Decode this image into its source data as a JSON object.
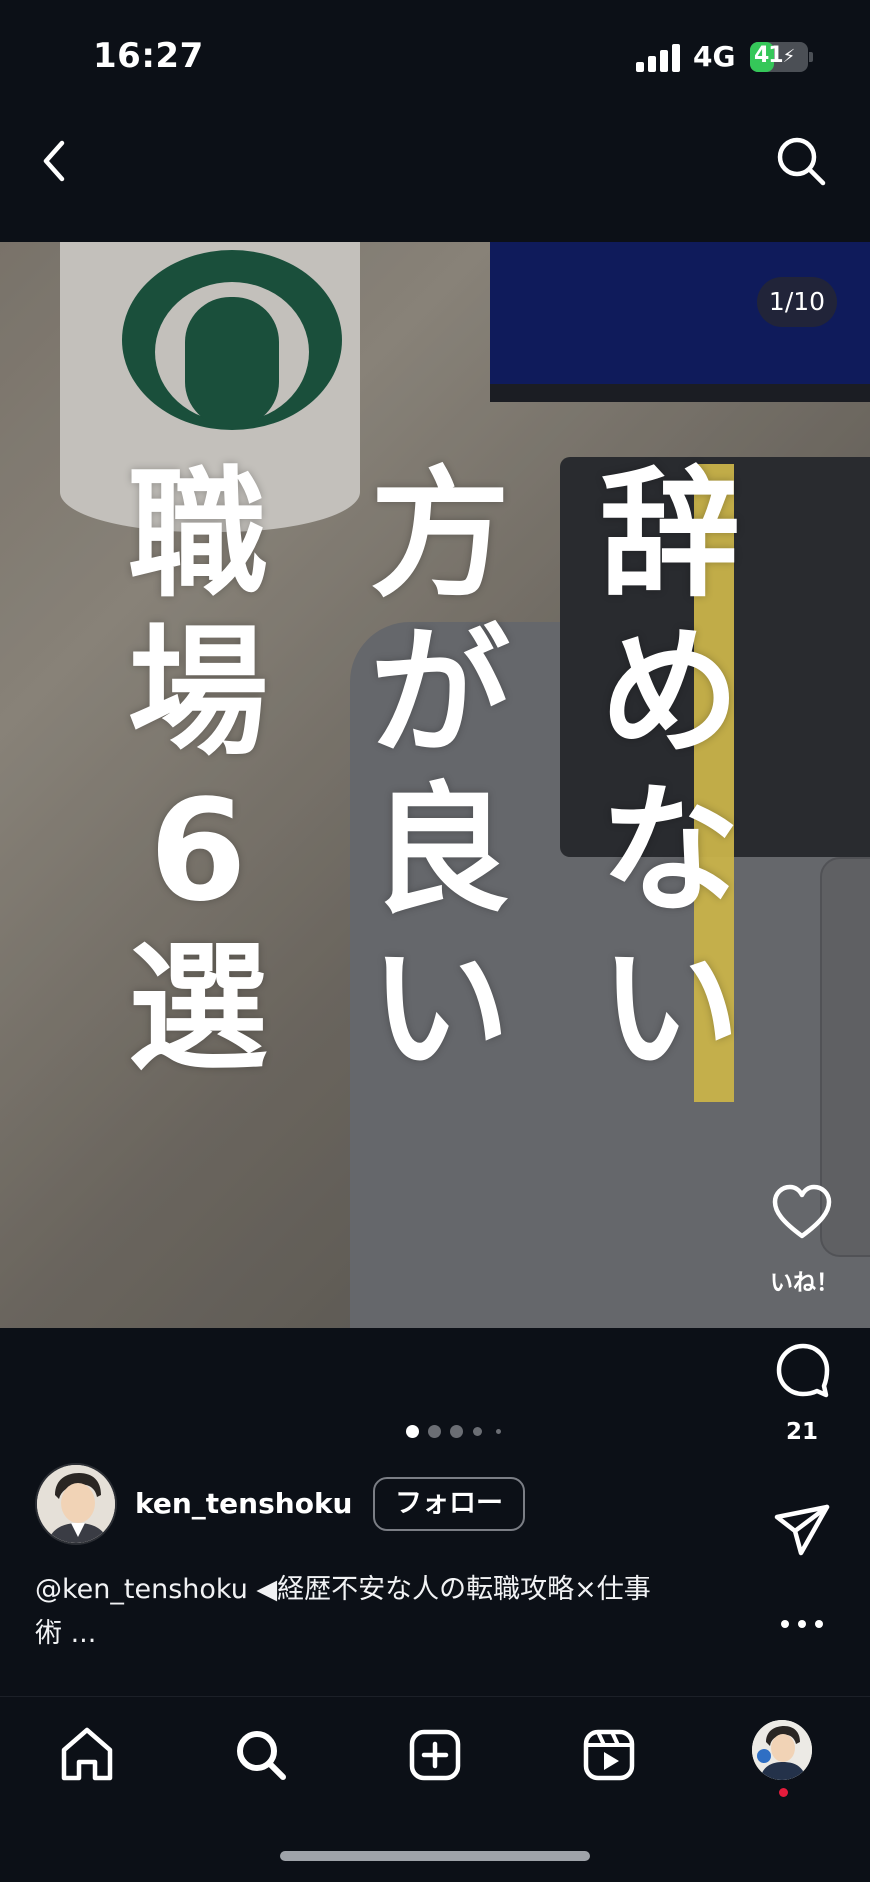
{
  "status": {
    "time": "16:27",
    "network": "4G",
    "battery": "41",
    "battery_level_fraction": 0.41
  },
  "nav": {
    "back_icon": "chevron-left-icon",
    "search_icon": "search-icon"
  },
  "post": {
    "image_counter": "1/10",
    "overlay_text": {
      "column_1": [
        "辞",
        "め",
        "な",
        "い"
      ],
      "column_2": [
        "方",
        "が",
        "良",
        "い"
      ],
      "column_3": [
        "職",
        "場",
        "6",
        "選"
      ]
    },
    "highlight_color": "#c9b34a",
    "carousel_dots": 5,
    "carousel_active_index": 0
  },
  "actions": {
    "like_label": "いね！",
    "comment_count": "21",
    "share_icon": "send-icon",
    "more_icon": "more-horizontal-icon"
  },
  "author": {
    "username": "ken_tenshoku",
    "follow_label": "フォロー"
  },
  "caption": {
    "line_1": "@ken_tenshoku ◀経歴不安な人の転職攻略×仕事",
    "line_2": "術 ..."
  },
  "tabbar": {
    "items": [
      {
        "icon": "home-icon"
      },
      {
        "icon": "search-icon"
      },
      {
        "icon": "create-plus-icon"
      },
      {
        "icon": "reels-icon"
      },
      {
        "icon": "profile-avatar-icon"
      }
    ],
    "notification_dot_color": "#e41c3c"
  }
}
